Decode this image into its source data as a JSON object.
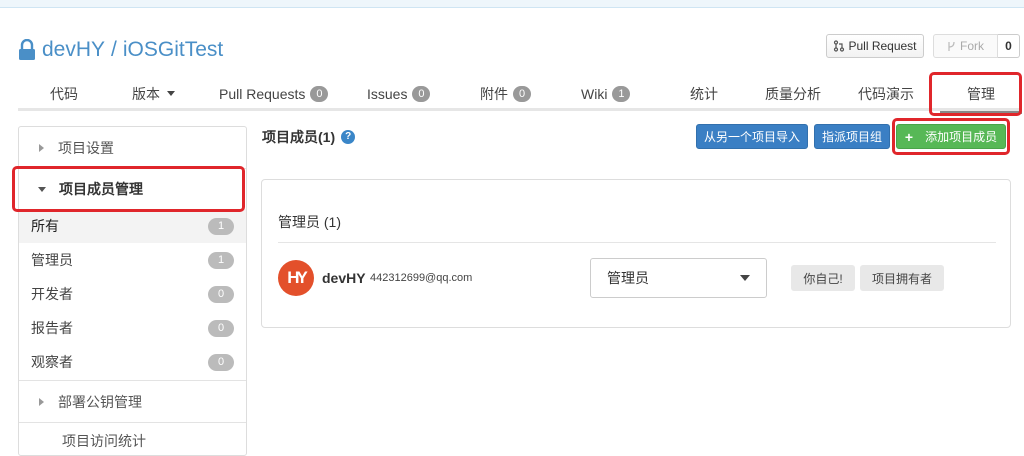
{
  "repo": {
    "owner": "devHY",
    "separator": "/",
    "name": "iOSGitTest"
  },
  "actions": {
    "pull_request_label": "Pull Request",
    "fork_label": "Fork",
    "fork_count": "0"
  },
  "tabs": [
    {
      "label": "代码"
    },
    {
      "label": "版本"
    },
    {
      "label": "Pull Requests",
      "count": "0"
    },
    {
      "label": "Issues",
      "count": "0"
    },
    {
      "label": "附件",
      "count": "0"
    },
    {
      "label": "Wiki",
      "count": "1"
    },
    {
      "label": "统计"
    },
    {
      "label": "质量分析"
    },
    {
      "label": "代码演示"
    },
    {
      "label": "管理"
    }
  ],
  "sidebar": {
    "project_settings": "项目设置",
    "members_admin": "项目成员管理",
    "items": [
      {
        "label": "所有",
        "count": "1"
      },
      {
        "label": "管理员",
        "count": "1"
      },
      {
        "label": "开发者",
        "count": "0"
      },
      {
        "label": "报告者",
        "count": "0"
      },
      {
        "label": "观察者",
        "count": "0"
      }
    ],
    "deploy_keys": "部署公钥管理",
    "access_stats": "项目访问统计"
  },
  "main": {
    "title": "项目成员(1)",
    "help_glyph": "?",
    "import_button": "从另一个项目导入",
    "assign_group_button": "指派项目组",
    "add_member_button": "添加项目成员",
    "add_glyph": "+"
  },
  "panel": {
    "heading": "管理员 (1)",
    "member": {
      "avatar_text": "HY",
      "username": "devHY",
      "email": "442312699@qq.com",
      "role": "管理员",
      "tag_self": "你自己!",
      "tag_owner": "项目拥有者"
    }
  },
  "colors": {
    "link_blue": "#4a8fc7",
    "primary_blue": "#3a7fc4",
    "success_green": "#57b856",
    "highlight_red": "#e0262b",
    "avatar_orange": "#e3502b"
  }
}
